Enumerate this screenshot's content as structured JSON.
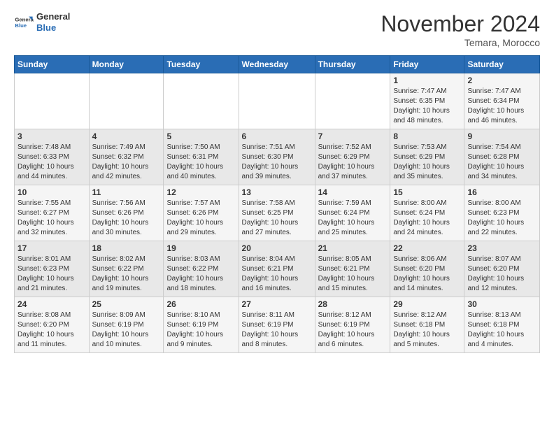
{
  "logo": {
    "general": "General",
    "blue": "Blue"
  },
  "header": {
    "month": "November 2024",
    "location": "Temara, Morocco"
  },
  "weekdays": [
    "Sunday",
    "Monday",
    "Tuesday",
    "Wednesday",
    "Thursday",
    "Friday",
    "Saturday"
  ],
  "weeks": [
    [
      {
        "day": "",
        "info": ""
      },
      {
        "day": "",
        "info": ""
      },
      {
        "day": "",
        "info": ""
      },
      {
        "day": "",
        "info": ""
      },
      {
        "day": "",
        "info": ""
      },
      {
        "day": "1",
        "info": "Sunrise: 7:47 AM\nSunset: 6:35 PM\nDaylight: 10 hours\nand 48 minutes."
      },
      {
        "day": "2",
        "info": "Sunrise: 7:47 AM\nSunset: 6:34 PM\nDaylight: 10 hours\nand 46 minutes."
      }
    ],
    [
      {
        "day": "3",
        "info": "Sunrise: 7:48 AM\nSunset: 6:33 PM\nDaylight: 10 hours\nand 44 minutes."
      },
      {
        "day": "4",
        "info": "Sunrise: 7:49 AM\nSunset: 6:32 PM\nDaylight: 10 hours\nand 42 minutes."
      },
      {
        "day": "5",
        "info": "Sunrise: 7:50 AM\nSunset: 6:31 PM\nDaylight: 10 hours\nand 40 minutes."
      },
      {
        "day": "6",
        "info": "Sunrise: 7:51 AM\nSunset: 6:30 PM\nDaylight: 10 hours\nand 39 minutes."
      },
      {
        "day": "7",
        "info": "Sunrise: 7:52 AM\nSunset: 6:29 PM\nDaylight: 10 hours\nand 37 minutes."
      },
      {
        "day": "8",
        "info": "Sunrise: 7:53 AM\nSunset: 6:29 PM\nDaylight: 10 hours\nand 35 minutes."
      },
      {
        "day": "9",
        "info": "Sunrise: 7:54 AM\nSunset: 6:28 PM\nDaylight: 10 hours\nand 34 minutes."
      }
    ],
    [
      {
        "day": "10",
        "info": "Sunrise: 7:55 AM\nSunset: 6:27 PM\nDaylight: 10 hours\nand 32 minutes."
      },
      {
        "day": "11",
        "info": "Sunrise: 7:56 AM\nSunset: 6:26 PM\nDaylight: 10 hours\nand 30 minutes."
      },
      {
        "day": "12",
        "info": "Sunrise: 7:57 AM\nSunset: 6:26 PM\nDaylight: 10 hours\nand 29 minutes."
      },
      {
        "day": "13",
        "info": "Sunrise: 7:58 AM\nSunset: 6:25 PM\nDaylight: 10 hours\nand 27 minutes."
      },
      {
        "day": "14",
        "info": "Sunrise: 7:59 AM\nSunset: 6:24 PM\nDaylight: 10 hours\nand 25 minutes."
      },
      {
        "day": "15",
        "info": "Sunrise: 8:00 AM\nSunset: 6:24 PM\nDaylight: 10 hours\nand 24 minutes."
      },
      {
        "day": "16",
        "info": "Sunrise: 8:00 AM\nSunset: 6:23 PM\nDaylight: 10 hours\nand 22 minutes."
      }
    ],
    [
      {
        "day": "17",
        "info": "Sunrise: 8:01 AM\nSunset: 6:23 PM\nDaylight: 10 hours\nand 21 minutes."
      },
      {
        "day": "18",
        "info": "Sunrise: 8:02 AM\nSunset: 6:22 PM\nDaylight: 10 hours\nand 19 minutes."
      },
      {
        "day": "19",
        "info": "Sunrise: 8:03 AM\nSunset: 6:22 PM\nDaylight: 10 hours\nand 18 minutes."
      },
      {
        "day": "20",
        "info": "Sunrise: 8:04 AM\nSunset: 6:21 PM\nDaylight: 10 hours\nand 16 minutes."
      },
      {
        "day": "21",
        "info": "Sunrise: 8:05 AM\nSunset: 6:21 PM\nDaylight: 10 hours\nand 15 minutes."
      },
      {
        "day": "22",
        "info": "Sunrise: 8:06 AM\nSunset: 6:20 PM\nDaylight: 10 hours\nand 14 minutes."
      },
      {
        "day": "23",
        "info": "Sunrise: 8:07 AM\nSunset: 6:20 PM\nDaylight: 10 hours\nand 12 minutes."
      }
    ],
    [
      {
        "day": "24",
        "info": "Sunrise: 8:08 AM\nSunset: 6:20 PM\nDaylight: 10 hours\nand 11 minutes."
      },
      {
        "day": "25",
        "info": "Sunrise: 8:09 AM\nSunset: 6:19 PM\nDaylight: 10 hours\nand 10 minutes."
      },
      {
        "day": "26",
        "info": "Sunrise: 8:10 AM\nSunset: 6:19 PM\nDaylight: 10 hours\nand 9 minutes."
      },
      {
        "day": "27",
        "info": "Sunrise: 8:11 AM\nSunset: 6:19 PM\nDaylight: 10 hours\nand 8 minutes."
      },
      {
        "day": "28",
        "info": "Sunrise: 8:12 AM\nSunset: 6:19 PM\nDaylight: 10 hours\nand 6 minutes."
      },
      {
        "day": "29",
        "info": "Sunrise: 8:12 AM\nSunset: 6:18 PM\nDaylight: 10 hours\nand 5 minutes."
      },
      {
        "day": "30",
        "info": "Sunrise: 8:13 AM\nSunset: 6:18 PM\nDaylight: 10 hours\nand 4 minutes."
      }
    ]
  ]
}
